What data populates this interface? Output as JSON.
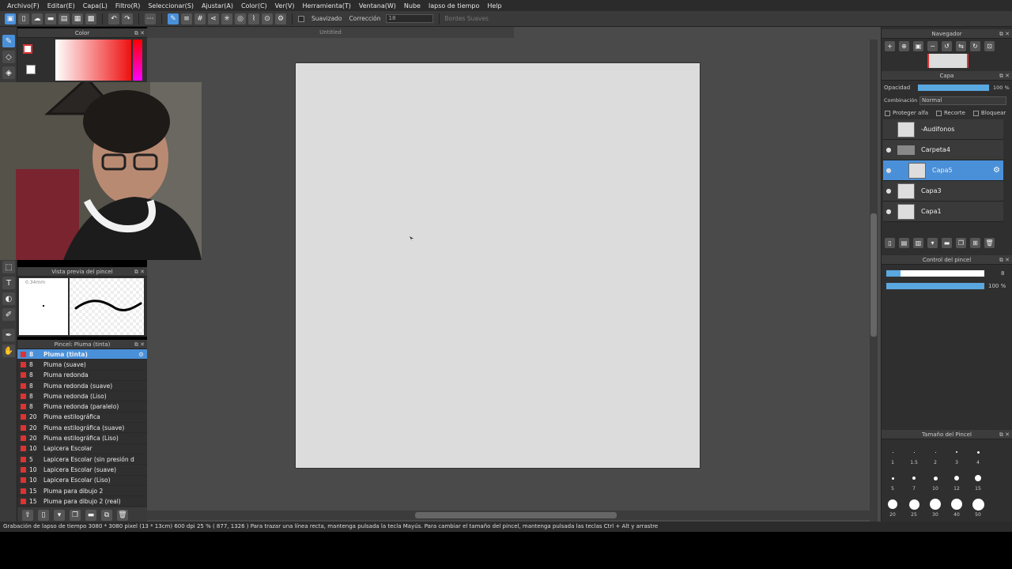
{
  "menu": [
    "Archivo(F)",
    "Editar(E)",
    "Capa(L)",
    "Filtro(R)",
    "Seleccionar(S)",
    "Ajustar(A)",
    "Color(C)",
    "Ver(V)",
    "Herramienta(T)",
    "Ventana(W)",
    "Nube",
    "lapso de tiempo",
    "Help"
  ],
  "toolbar": {
    "smoothing_label": "Suavizado",
    "correction_label": "Corrección",
    "correction_value": "18",
    "soft_edges_label": "Bordes Suaves"
  },
  "canvas": {
    "tab_title": "Untitled"
  },
  "color_panel": {
    "title": "Color"
  },
  "brush_preview": {
    "title": "Vista previa del pincel",
    "size_label": "0.34mm"
  },
  "brush_panel": {
    "title": "Pincel: Pluma (tinta)",
    "items": [
      {
        "size": "8",
        "name": "Pluma (tinta)",
        "selected": true
      },
      {
        "size": "8",
        "name": "Pluma (suave)"
      },
      {
        "size": "8",
        "name": "Pluma redonda"
      },
      {
        "size": "8",
        "name": "Pluma redonda (suave)"
      },
      {
        "size": "8",
        "name": "Pluma redonda (Liso)"
      },
      {
        "size": "8",
        "name": "Pluma redonda (paralelo)"
      },
      {
        "size": "20",
        "name": "Pluma estilográfica"
      },
      {
        "size": "20",
        "name": "Pluma estilográfica (suave)"
      },
      {
        "size": "20",
        "name": "Pluma estilográfica (Liso)"
      },
      {
        "size": "10",
        "name": "Lapicera Escolar"
      },
      {
        "size": "5",
        "name": "Lapicera Escolar (sin presión d"
      },
      {
        "size": "10",
        "name": "Lapicera Escolar (suave)"
      },
      {
        "size": "10",
        "name": "Lapicera Escolar (Liso)"
      },
      {
        "size": "15",
        "name": "Pluma para dibujo 2"
      },
      {
        "size": "15",
        "name": "Pluma para dibujo 2 (real)"
      }
    ]
  },
  "navigator": {
    "title": "Navegador"
  },
  "layer_panel": {
    "title": "Capa",
    "opacity_label": "Opacidad",
    "opacity_value": "100 %",
    "blend_label": "Combinación",
    "blend_value": "Normal",
    "protect_alpha": "Proteger alfa",
    "clipping": "Recorte",
    "lock": "Bloquear",
    "layers": [
      {
        "name": "-Audifonos",
        "kind": "layer"
      },
      {
        "name": "Carpeta4",
        "kind": "folder"
      },
      {
        "name": "Capa5",
        "kind": "layer",
        "selected": true
      },
      {
        "name": "Capa3",
        "kind": "layer"
      },
      {
        "name": "Capa1",
        "kind": "layer"
      }
    ]
  },
  "brush_control": {
    "title": "Control del pincel",
    "size_value": "8",
    "opacity_value": "100 %"
  },
  "brush_size_panel": {
    "title": "Tamaño del Pincel",
    "rows": [
      [
        "1",
        "1.5",
        "2",
        "3",
        "4"
      ],
      [
        "5",
        "7",
        "10",
        "12",
        "15"
      ],
      [
        "20",
        "25",
        "30",
        "40",
        "50"
      ]
    ]
  },
  "status": "Grabación de lapso de tiempo   3080 * 3080 pixel   (13 * 13cm)   600 dpi   25 %   ( 877, 1326 )   Para trazar una línea recta, mantenga pulsada la tecla Mayús. Para cambiar el tamaño del pincel, mantenga pulsada las teclas Ctrl + Alt y arrastre",
  "colors": {
    "accent": "#4a90d9",
    "brush_color": "#d33333"
  }
}
